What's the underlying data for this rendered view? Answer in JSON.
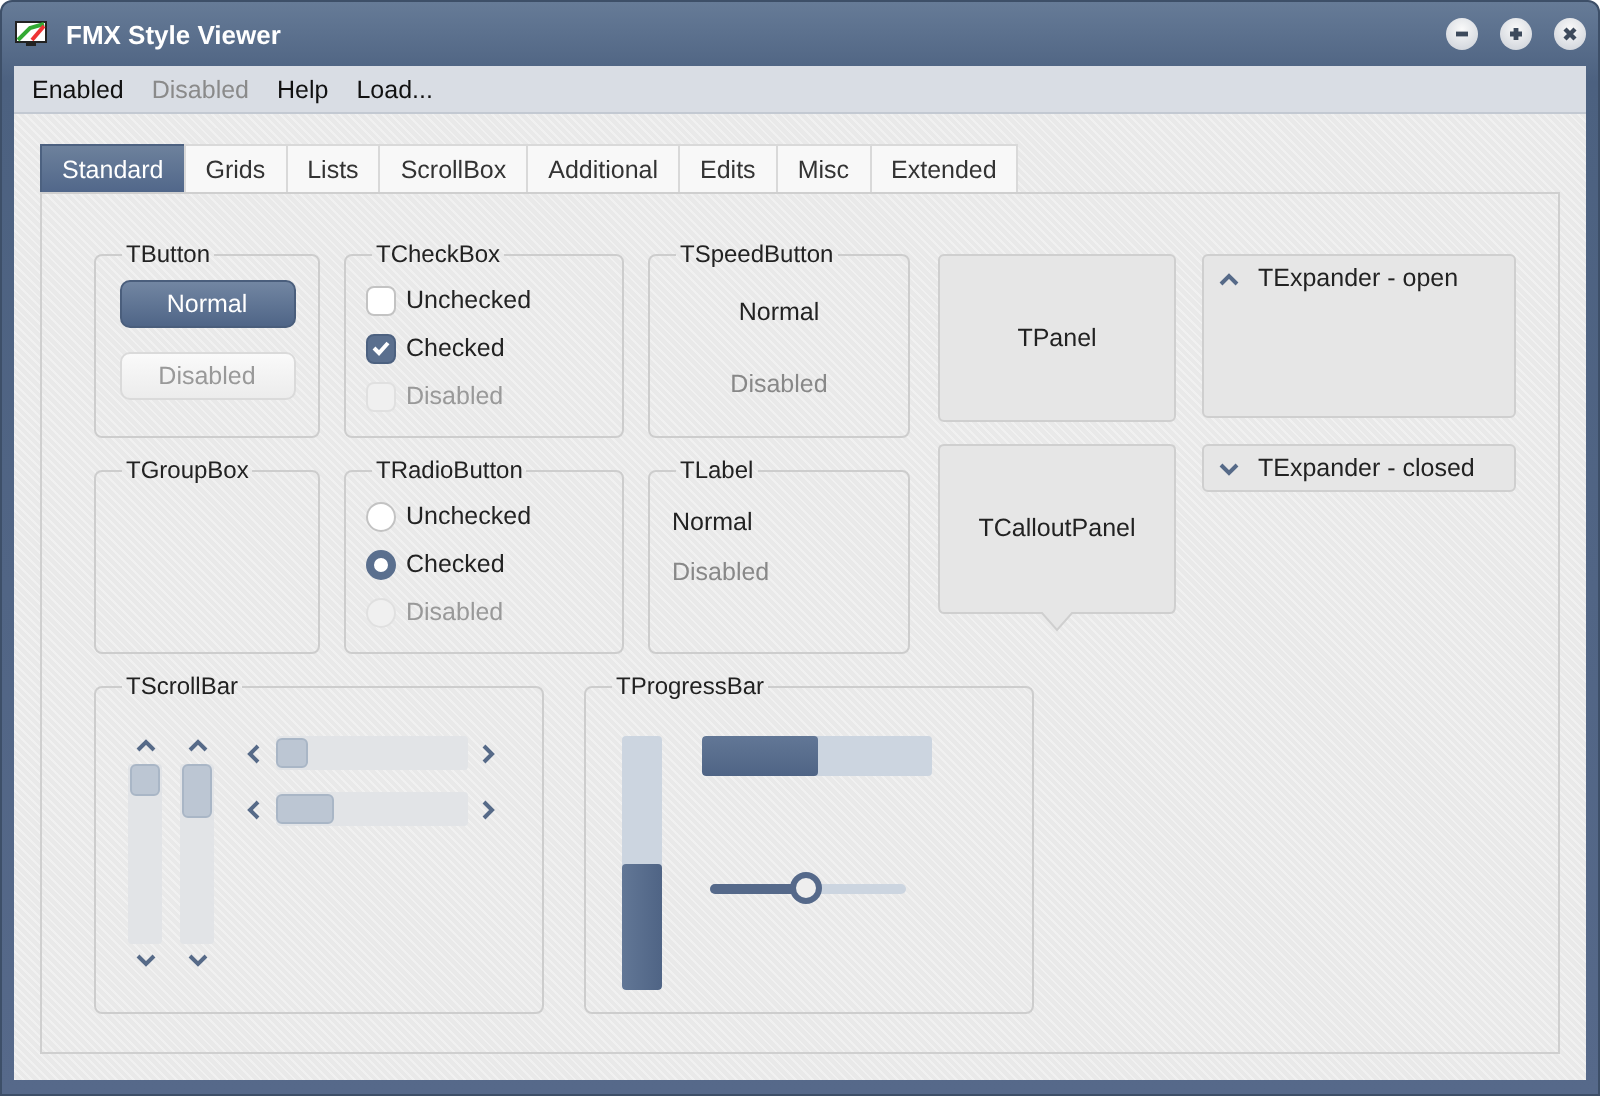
{
  "window": {
    "title": "FMX Style Viewer"
  },
  "menu": [
    {
      "label": "Enabled",
      "disabled": false
    },
    {
      "label": "Disabled",
      "disabled": true
    },
    {
      "label": "Help",
      "disabled": false
    },
    {
      "label": "Load...",
      "disabled": false
    }
  ],
  "tabs": [
    {
      "label": "Standard",
      "selected": true
    },
    {
      "label": "Grids",
      "selected": false
    },
    {
      "label": "Lists",
      "selected": false
    },
    {
      "label": "ScrollBox",
      "selected": false
    },
    {
      "label": "Additional",
      "selected": false
    },
    {
      "label": "Edits",
      "selected": false
    },
    {
      "label": "Misc",
      "selected": false
    },
    {
      "label": "Extended",
      "selected": false
    }
  ],
  "button_group": {
    "title": "TButton",
    "buttons": [
      {
        "label": "Normal",
        "disabled": false
      },
      {
        "label": "Disabled",
        "disabled": true
      }
    ]
  },
  "checkbox_group": {
    "title": "TCheckBox",
    "items": [
      {
        "label": "Unchecked",
        "checked": false,
        "disabled": false
      },
      {
        "label": "Checked",
        "checked": true,
        "disabled": false
      },
      {
        "label": "Disabled",
        "checked": false,
        "disabled": true
      }
    ]
  },
  "speedbutton_group": {
    "title": "TSpeedButton",
    "buttons": [
      {
        "label": "Normal",
        "disabled": false
      },
      {
        "label": "Disabled",
        "disabled": true
      }
    ]
  },
  "groupbox": {
    "title": "TGroupBox"
  },
  "radio_group": {
    "title": "TRadioButton",
    "items": [
      {
        "label": "Unchecked",
        "selected": false,
        "disabled": false
      },
      {
        "label": "Checked",
        "selected": true,
        "disabled": false
      },
      {
        "label": "Disabled",
        "selected": false,
        "disabled": true
      }
    ]
  },
  "label_group": {
    "title": "TLabel",
    "labels": [
      {
        "text": "Normal",
        "disabled": false
      },
      {
        "text": "Disabled",
        "disabled": true
      }
    ]
  },
  "panel": {
    "text": "TPanel"
  },
  "callout_panel": {
    "text": "TCalloutPanel"
  },
  "expanders": [
    {
      "title": "TExpander - open",
      "expanded": true
    },
    {
      "title": "TExpander - closed",
      "expanded": false
    }
  ],
  "scrollbar_group": {
    "title": "TScrollBar"
  },
  "progress_group": {
    "title": "TProgressBar",
    "vertical_bar": {
      "level": 0.5
    },
    "horizontal_bar": {
      "level": 0.5
    },
    "slider": {
      "level": 0.49
    }
  }
}
